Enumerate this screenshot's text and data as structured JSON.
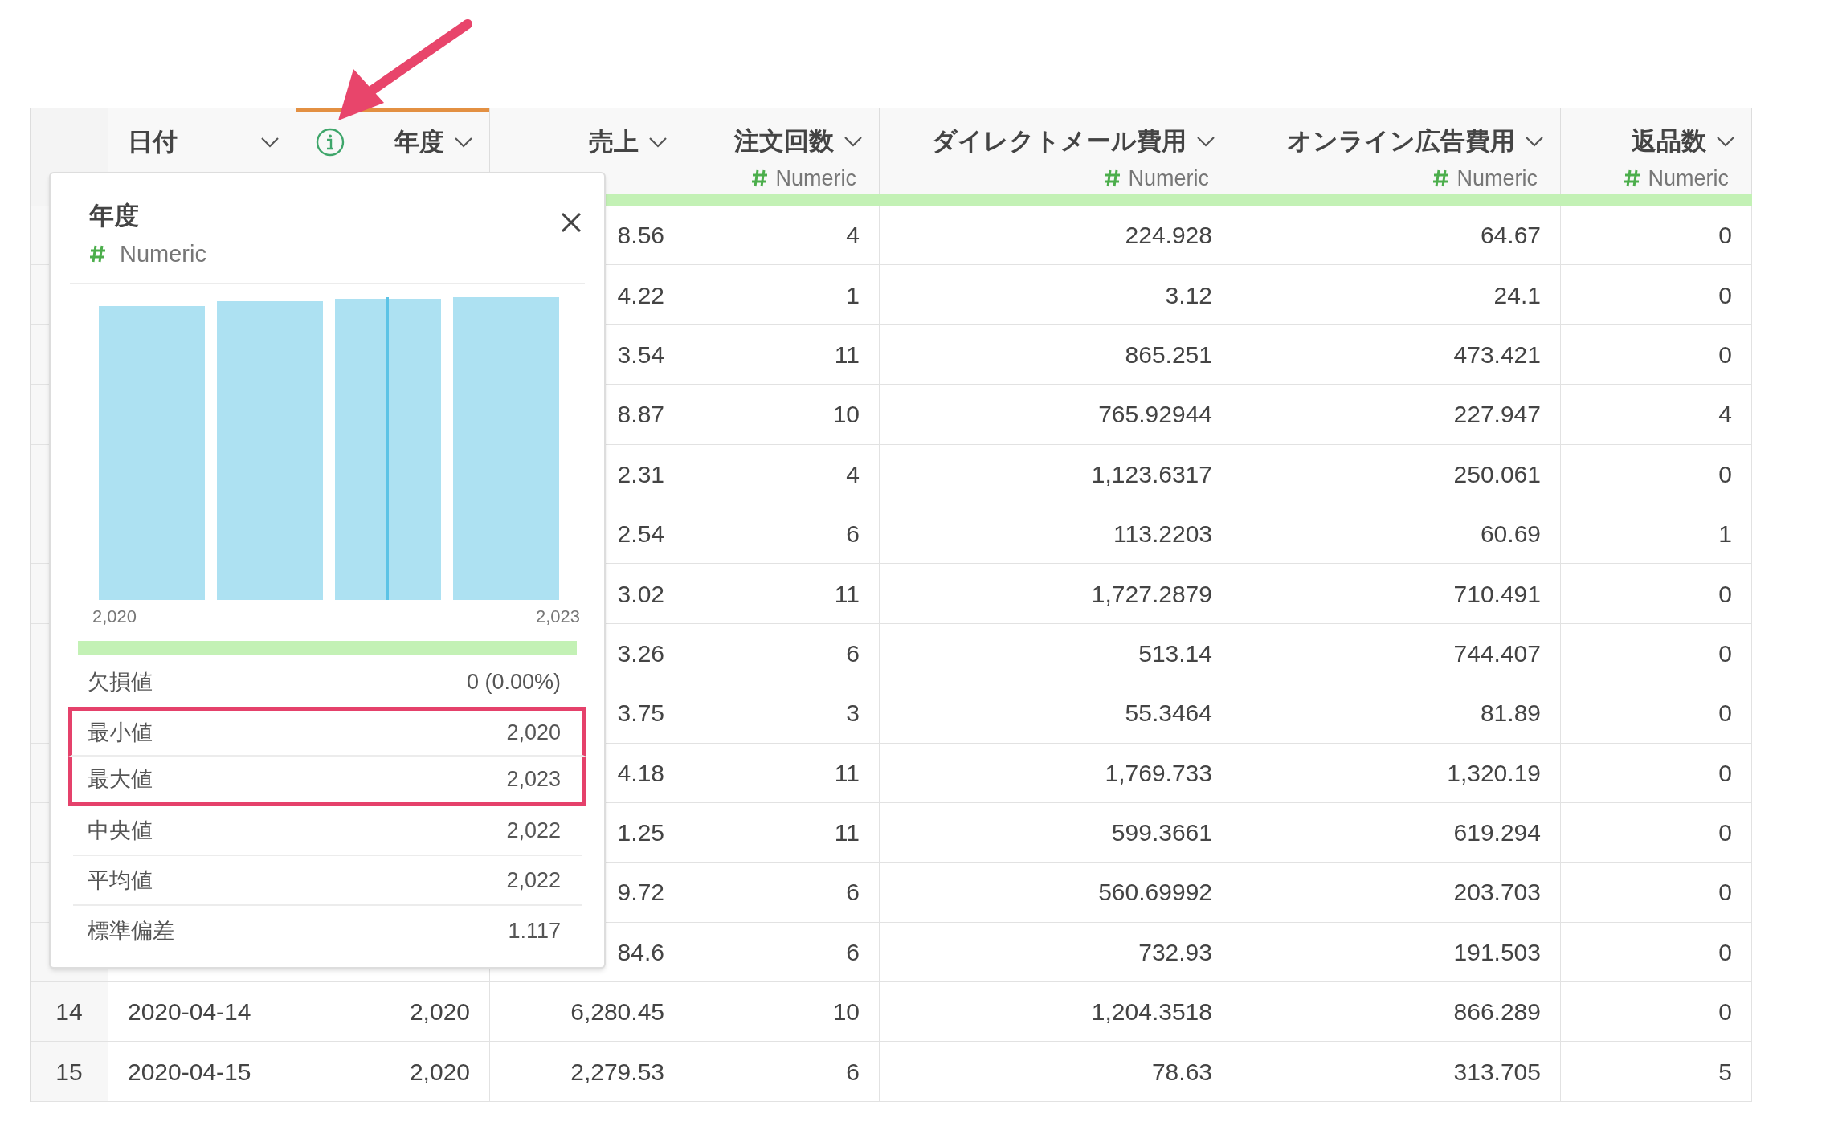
{
  "table": {
    "columns": [
      {
        "kind": "rownum"
      },
      {
        "kind": "date",
        "label": "日付",
        "selected": false
      },
      {
        "kind": "numeric",
        "label": "年度",
        "selected": true
      },
      {
        "kind": "numeric",
        "label": "売上",
        "selected": false
      },
      {
        "kind": "numeric",
        "label": "注文回数",
        "type": "Numeric",
        "selected": false
      },
      {
        "kind": "numeric",
        "label": "ダイレクトメール費用",
        "type": "Numeric",
        "selected": false
      },
      {
        "kind": "numeric",
        "label": "オンライン広告費用",
        "type": "Numeric",
        "selected": false
      },
      {
        "kind": "numeric",
        "label": "返品数",
        "type": "Numeric",
        "selected": false
      }
    ],
    "rows": [
      {
        "sales": "8.56",
        "orders": "4",
        "dm_cost": "224.928",
        "ad_cost": "64.67",
        "returns": "0"
      },
      {
        "sales": "4.22",
        "orders": "1",
        "dm_cost": "3.12",
        "ad_cost": "24.1",
        "returns": "0"
      },
      {
        "sales": "3.54",
        "orders": "11",
        "dm_cost": "865.251",
        "ad_cost": "473.421",
        "returns": "0"
      },
      {
        "sales": "8.87",
        "orders": "10",
        "dm_cost": "765.92944",
        "ad_cost": "227.947",
        "returns": "4"
      },
      {
        "sales": "2.31",
        "orders": "4",
        "dm_cost": "1,123.6317",
        "ad_cost": "250.061",
        "returns": "0"
      },
      {
        "sales": "2.54",
        "orders": "6",
        "dm_cost": "113.2203",
        "ad_cost": "60.69",
        "returns": "1"
      },
      {
        "sales": "3.02",
        "orders": "11",
        "dm_cost": "1,727.2879",
        "ad_cost": "710.491",
        "returns": "0"
      },
      {
        "sales": "3.26",
        "orders": "6",
        "dm_cost": "513.14",
        "ad_cost": "744.407",
        "returns": "0"
      },
      {
        "sales": "3.75",
        "orders": "3",
        "dm_cost": "55.3464",
        "ad_cost": "81.89",
        "returns": "0"
      },
      {
        "sales": "4.18",
        "orders": "11",
        "dm_cost": "1,769.733",
        "ad_cost": "1,320.19",
        "returns": "0"
      },
      {
        "sales": "1.25",
        "orders": "11",
        "dm_cost": "599.3661",
        "ad_cost": "619.294",
        "returns": "0"
      },
      {
        "sales": "9.72",
        "orders": "6",
        "dm_cost": "560.69992",
        "ad_cost": "203.703",
        "returns": "0"
      },
      {
        "sales": "84.6",
        "orders": "6",
        "dm_cost": "732.93",
        "ad_cost": "191.503",
        "returns": "0"
      },
      {
        "number": "14",
        "date": "2020-04-14",
        "year": "2,020",
        "sales": "6,280.45",
        "orders": "10",
        "dm_cost": "1,204.3518",
        "ad_cost": "866.289",
        "returns": "0"
      },
      {
        "number": "15",
        "date": "2020-04-15",
        "year": "2,020",
        "sales": "2,279.53",
        "orders": "6",
        "dm_cost": "78.63",
        "ad_cost": "313.705",
        "returns": "5"
      }
    ]
  },
  "popup": {
    "title": "年度",
    "type": "Numeric",
    "axis_min": "2,020",
    "axis_max": "2,023",
    "stats": [
      {
        "label": "欠損値",
        "value": "0 (0.00%)",
        "highlighted": false
      },
      {
        "label": "最小値",
        "value": "2,020",
        "highlighted": true
      },
      {
        "label": "最大値",
        "value": "2,023",
        "highlighted": true
      },
      {
        "label": "中央値",
        "value": "2,022",
        "highlighted": false
      },
      {
        "label": "平均値",
        "value": "2,022",
        "highlighted": false
      },
      {
        "label": "標準偏差",
        "value": "1.117",
        "highlighted": false
      }
    ]
  }
}
